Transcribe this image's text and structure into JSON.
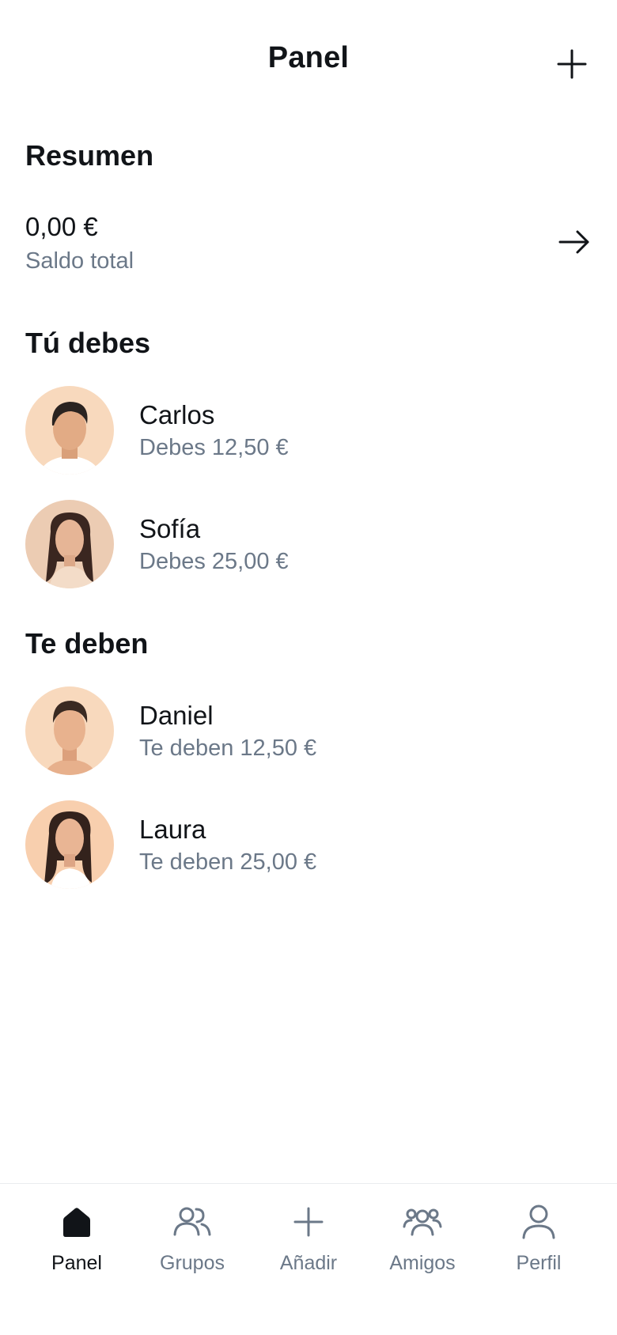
{
  "header": {
    "title": "Panel",
    "add_icon": "plus-icon"
  },
  "summary": {
    "title": "Resumen",
    "balance": "0,00 €",
    "balance_label": "Saldo total",
    "arrow_icon": "arrow-right-icon"
  },
  "you_owe": {
    "title": "Tú debes",
    "items": [
      {
        "name": "Carlos",
        "detail": "Debes 12,50 €"
      },
      {
        "name": "Sofía",
        "detail": "Debes 25,00 €"
      }
    ]
  },
  "owed_to_you": {
    "title": "Te deben",
    "items": [
      {
        "name": "Daniel",
        "detail": "Te deben 12,50 €"
      },
      {
        "name": "Laura",
        "detail": "Te deben 25,00 €"
      }
    ]
  },
  "nav": {
    "items": [
      {
        "label": "Panel",
        "icon": "home-icon",
        "active": true
      },
      {
        "label": "Grupos",
        "icon": "group-icon",
        "active": false
      },
      {
        "label": "Añadir",
        "icon": "plus-icon",
        "active": false
      },
      {
        "label": "Amigos",
        "icon": "friends-icon",
        "active": false
      },
      {
        "label": "Perfil",
        "icon": "user-icon",
        "active": false
      }
    ]
  },
  "colors": {
    "text_primary": "#111418",
    "text_secondary": "#6b7888",
    "avatar_bg": "#f8d9bd"
  }
}
